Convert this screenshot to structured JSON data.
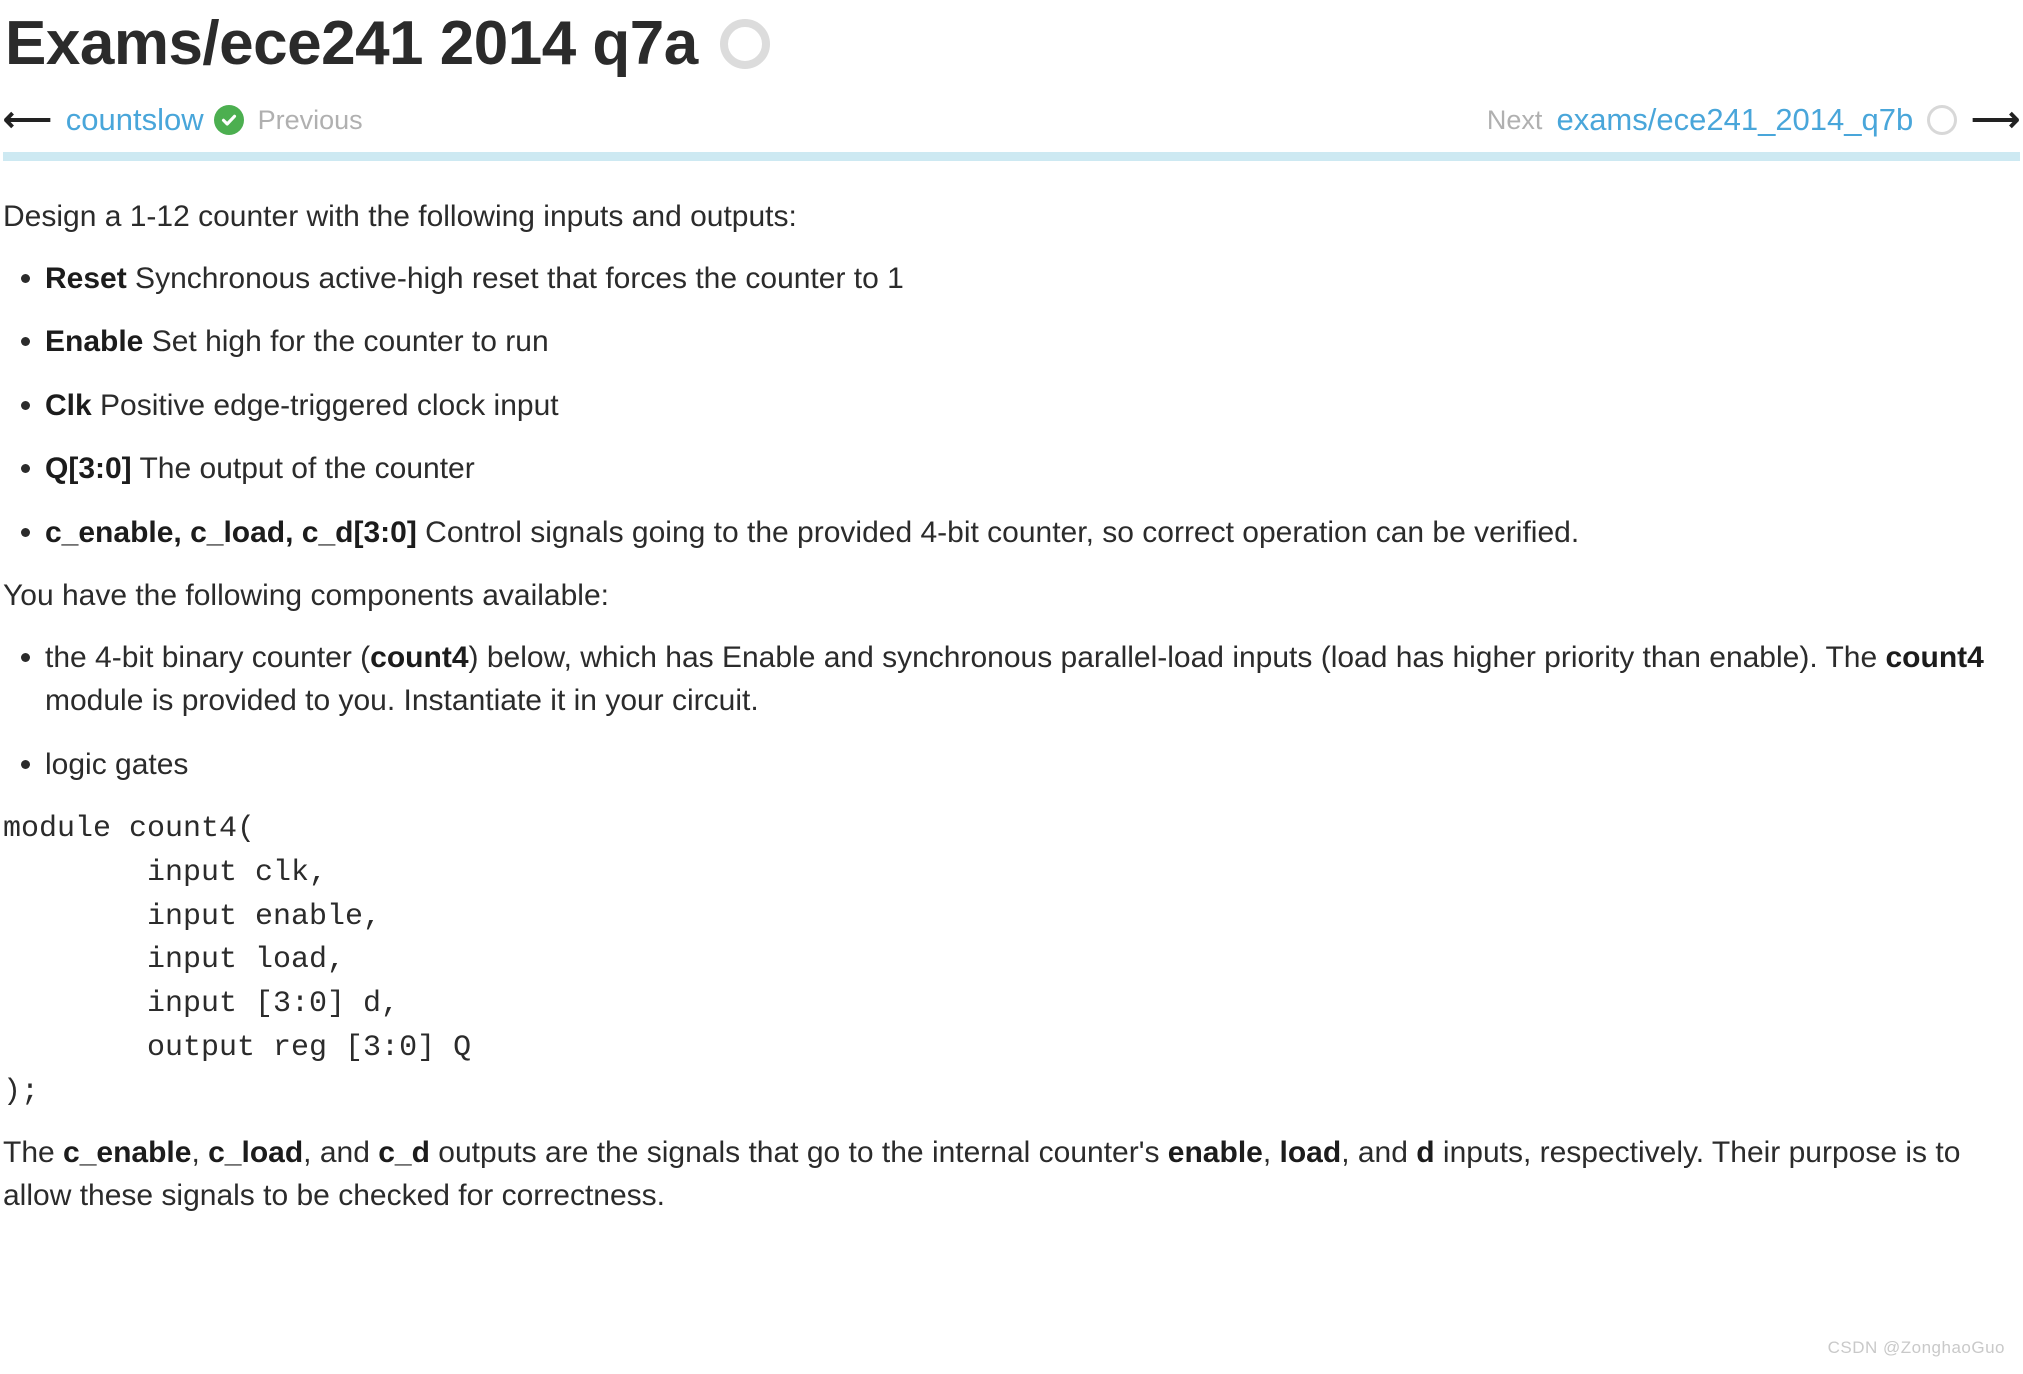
{
  "header": {
    "title": "Exams/ece241 2014 q7a",
    "status_icon": "empty-circle-icon"
  },
  "nav": {
    "back_arrow_icon": "arrow-left-icon",
    "prev_link": "countslow",
    "prev_status_icon": "green-check-icon",
    "prev_label": "Previous",
    "next_label": "Next",
    "next_link": "exams/ece241_2014_q7b",
    "next_status_icon": "empty-circle-icon",
    "forward_arrow_icon": "arrow-right-icon"
  },
  "colors": {
    "link": "#49a6da",
    "rule": "#cde9f2",
    "check_green": "#4caf50",
    "muted": "#b0b0b0",
    "text": "#2b2b2b",
    "circle_gray": "#dcdcdc"
  },
  "content": {
    "intro": "Design a 1-12 counter with the following inputs and outputs:",
    "io_list": [
      {
        "term": "Reset",
        "desc": " Synchronous active-high reset that forces the counter to 1"
      },
      {
        "term": "Enable",
        "desc": " Set high for the counter to run"
      },
      {
        "term": "Clk",
        "desc": " Positive edge-triggered clock input"
      },
      {
        "term": "Q[3:0]",
        "desc": " The output of the counter"
      },
      {
        "term": "c_enable, c_load, c_d[3:0]",
        "desc": " Control signals going to the provided 4-bit counter, so correct operation can be verified."
      }
    ],
    "components_intro": "You have the following components available:",
    "components_item_1_a": "the 4-bit binary counter (",
    "components_item_1_b": "count4",
    "components_item_1_c": ") below, which has Enable and synchronous parallel-load inputs (load has higher priority than enable). The ",
    "components_item_1_d": "count4",
    "components_item_1_e": " module is provided to you. Instantiate it in your circuit.",
    "components_item_2": "logic gates",
    "code": "module count4(\n        input clk,\n        input enable,\n        input load,\n        input [3:0] d,\n        output reg [3:0] Q\n);",
    "closing_1": "The ",
    "closing_b1": "c_enable",
    "closing_2": ", ",
    "closing_b2": "c_load",
    "closing_3": ", and ",
    "closing_b3": "c_d",
    "closing_4": " outputs are the signals that go to the internal counter's ",
    "closing_b4": "enable",
    "closing_5": ", ",
    "closing_b5": "load",
    "closing_6": ", and ",
    "closing_b6": "d",
    "closing_7": " inputs, respectively. Their purpose is to allow these signals to be checked for correctness."
  },
  "watermark": "CSDN @ZonghaoGuo"
}
